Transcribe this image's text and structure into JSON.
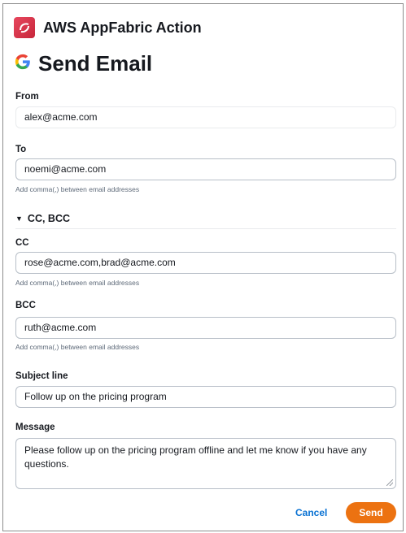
{
  "header": {
    "app_title": "AWS AppFabric Action",
    "logo_icon": "appfabric-logo-icon"
  },
  "page": {
    "title": "Send Email",
    "provider_icon": "google-g-icon"
  },
  "form": {
    "from": {
      "label": "From",
      "value": "alex@acme.com"
    },
    "to": {
      "label": "To",
      "value": "noemi@acme.com",
      "hint": "Add comma(,) between email addresses"
    },
    "cc_bcc_section": {
      "label": "CC, BCC",
      "expanded": true
    },
    "cc": {
      "label": "CC",
      "value": "rose@acme.com,brad@acme.com",
      "hint": "Add comma(,) between email addresses"
    },
    "bcc": {
      "label": "BCC",
      "value": "ruth@acme.com",
      "hint": "Add comma(,) between email addresses"
    },
    "subject": {
      "label": "Subject line",
      "value": "Follow up on the pricing program"
    },
    "message": {
      "label": "Message",
      "value": "Please follow up on the pricing program offline and let me know if you have any questions."
    }
  },
  "actions": {
    "cancel_label": "Cancel",
    "send_label": "Send"
  },
  "colors": {
    "accent": "#ec7211",
    "link": "#0972d3",
    "brand": "#d6334a"
  }
}
